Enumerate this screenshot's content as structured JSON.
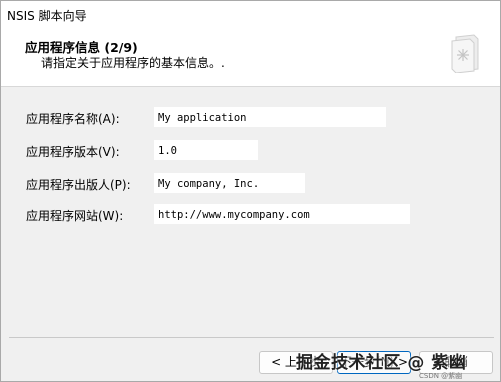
{
  "window": {
    "title": "NSIS 脚本向导"
  },
  "header": {
    "title": "应用程序信息 (2/9)",
    "subtitle": "请指定关于应用程序的基本信息。."
  },
  "form": {
    "fields": [
      {
        "label": "应用程序名称(A):",
        "value": "My application"
      },
      {
        "label": "应用程序版本(V):",
        "value": "1.0"
      },
      {
        "label": "应用程序出版人(P):",
        "value": "My company, Inc."
      },
      {
        "label": "应用程序网站(W):",
        "value": "http://www.mycompany.com"
      }
    ]
  },
  "footer": {
    "back_label": "< 上一步",
    "next_label": "下一步(N) >",
    "cancel_label": "取消"
  },
  "watermark": {
    "text": "掘金技术社区 @ 紫幽",
    "small": "CSDN @紫幽"
  },
  "colors": {
    "accent": "#0067c0",
    "background": "#f0f0f0"
  },
  "icons": {
    "header": "install-wizard-icon"
  }
}
